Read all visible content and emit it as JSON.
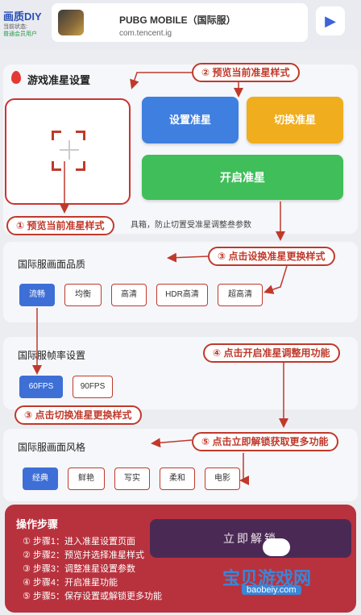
{
  "header": {
    "brand_title": "画质DIY",
    "brand_status": "当前状态:",
    "brand_user": "普通会员用户",
    "game_name": "PUBG MOBILE（国际服）",
    "game_package": "com.tencent.ig"
  },
  "crosshair": {
    "section_title": "游戏准星设置",
    "set_button": "设置准星",
    "switch_button": "切换准星",
    "open_button": "开启准星",
    "tip": "具箱，防止切置受准星调整叁参数"
  },
  "quality": {
    "title": "国际服画面品质",
    "options": [
      "流畅",
      "均衡",
      "高清",
      "HDR高清",
      "超高清"
    ],
    "selected": "流畅"
  },
  "framerate": {
    "title": "国际服帧率设置",
    "options": [
      "60FPS",
      "90FPS"
    ],
    "selected": "60FPS"
  },
  "style": {
    "title": "国际服画面风格",
    "options": [
      "经典",
      "鲜艳",
      "写实",
      "柔和",
      "电影"
    ],
    "selected": "经典"
  },
  "steps": {
    "title": "操作步骤",
    "items": [
      "① 步骤1：进入准星设置页面",
      "② 步骤2：预览并选择准星样式",
      "③ 步骤3：调整准星设置参数",
      "④ 步骤4：开启准星功能",
      "⑤ 步骤5：保存设置或解锁更多功能"
    ],
    "unlock_button": "立即解锁"
  },
  "annotations": {
    "a1": "① 预览当前准星样式",
    "a2": "② 预览当前准星样式",
    "a3": "③ 点击设换准星更换样式",
    "a3b": "③ 点击切换准星更换样式",
    "a4": "④ 点击开启准星调整用功能",
    "a5": "⑤ 点击立即解锁获取更多功能"
  },
  "watermark": {
    "cn": "宝贝游戏网",
    "en": "baobeiy.com"
  },
  "colors": {
    "primary_blue": "#3f7fe0",
    "orange": "#f0ad1e",
    "green": "#3fbe5a",
    "annotation_red": "#c0392b",
    "steps_panel": "#b8323e"
  }
}
